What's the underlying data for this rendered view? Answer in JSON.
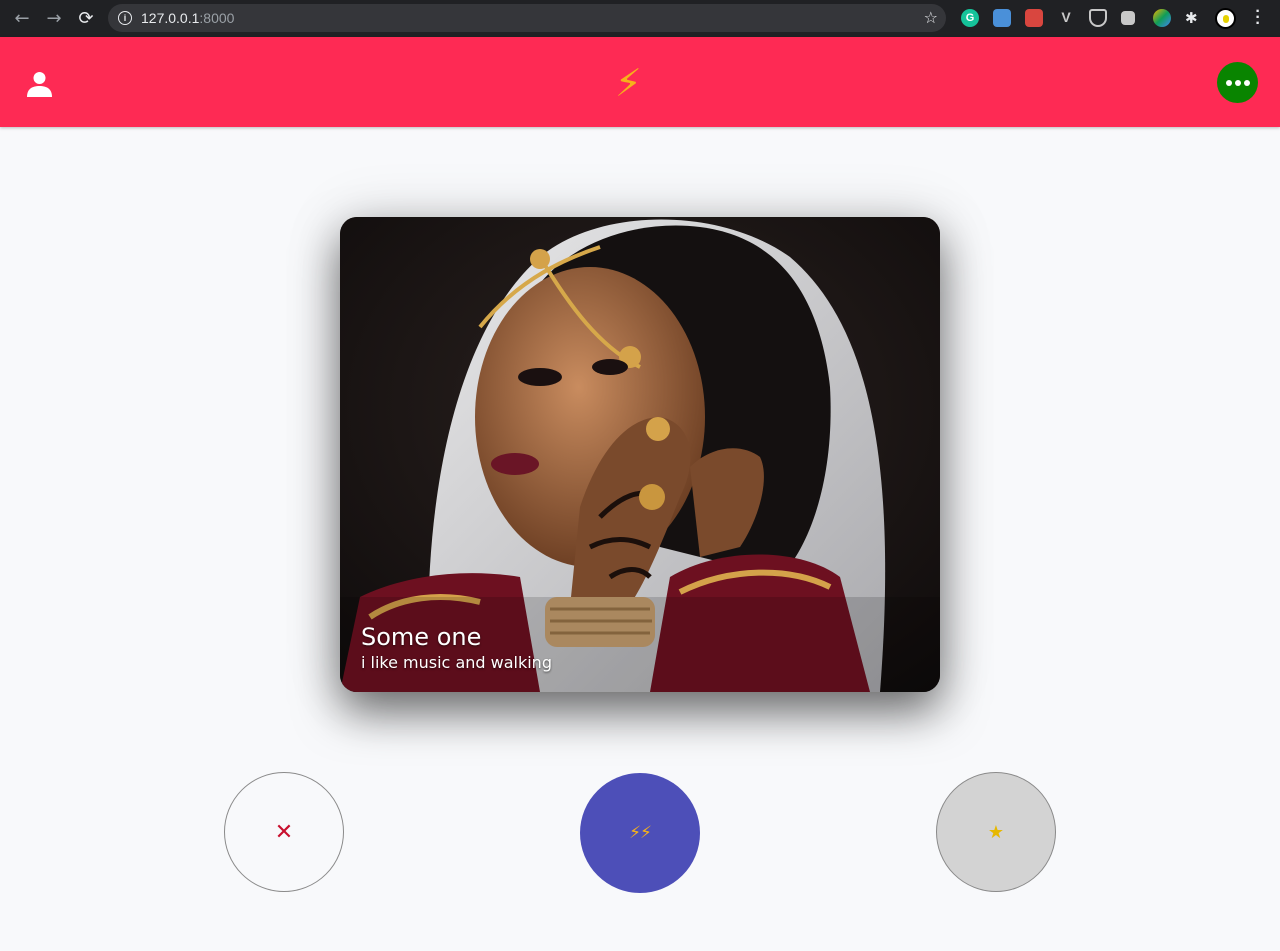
{
  "browser": {
    "url_host": "127.0.0.1",
    "url_port": ":8000",
    "back_icon": "←",
    "forward_icon": "→",
    "reload_icon": "⟳",
    "star_icon": "☆",
    "extension_icon": "✱"
  },
  "header": {
    "background_color": "#fe2a54",
    "logo_symbol": "⚡",
    "more_button_color": "#098400"
  },
  "card": {
    "name": "Some one",
    "bio": "i like music and walking"
  },
  "actions": {
    "nope_symbol": "✕",
    "like_symbol": "⚡⚡",
    "super_symbol": "★",
    "like_color": "#4d4fb8"
  }
}
